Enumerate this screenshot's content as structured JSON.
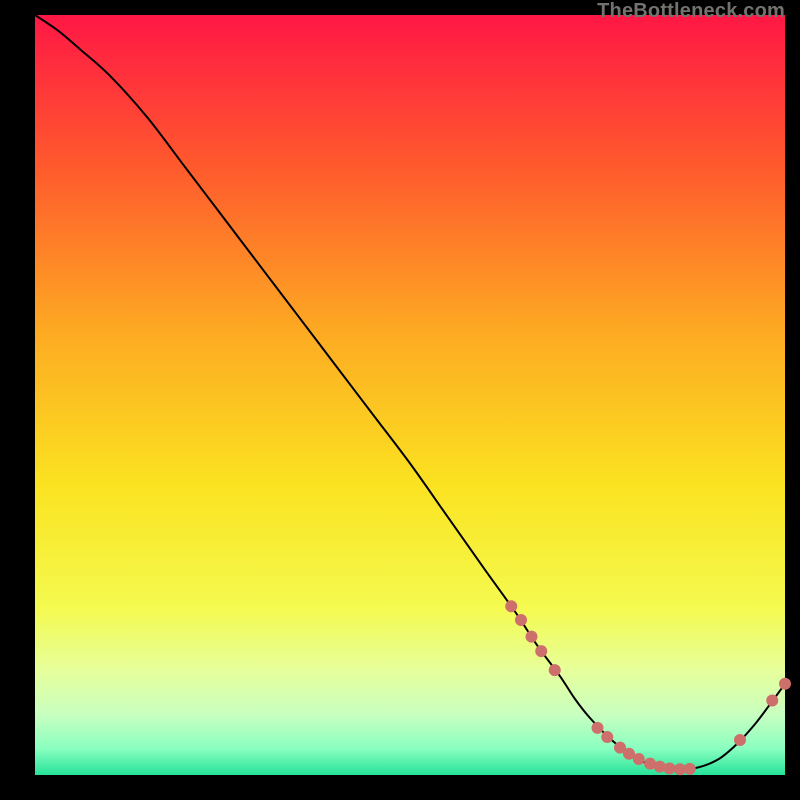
{
  "attribution": "TheBottleneck.com",
  "colors": {
    "background": "#000000",
    "curve": "#000000",
    "marker": "#cd6f6b",
    "gradient_stops": [
      {
        "pos": 0.0,
        "c": "#ff1745"
      },
      {
        "pos": 0.2,
        "c": "#ff5a2d"
      },
      {
        "pos": 0.42,
        "c": "#fdab22"
      },
      {
        "pos": 0.62,
        "c": "#fbe321"
      },
      {
        "pos": 0.78,
        "c": "#f4fa4f"
      },
      {
        "pos": 0.86,
        "c": "#e7ff99"
      },
      {
        "pos": 0.92,
        "c": "#c9ffc0"
      },
      {
        "pos": 0.965,
        "c": "#8affc0"
      },
      {
        "pos": 1.0,
        "c": "#26e39a"
      }
    ]
  },
  "chart_data": {
    "type": "line",
    "title": "",
    "xlabel": "",
    "ylabel": "",
    "xlim": [
      0,
      100
    ],
    "ylim": [
      0,
      100
    ],
    "x": [
      0,
      3,
      6,
      10,
      15,
      20,
      25,
      30,
      35,
      40,
      45,
      50,
      55,
      60,
      64,
      67,
      70,
      72,
      74,
      77,
      80,
      82.5,
      85,
      88,
      91,
      93.5,
      96,
      98,
      100
    ],
    "y": [
      100,
      98,
      95.5,
      92,
      86.5,
      80,
      73.5,
      67,
      60.5,
      54,
      47.5,
      41,
      34,
      27,
      21.5,
      17,
      13,
      10,
      7.5,
      4.5,
      2.3,
      1.2,
      0.7,
      0.9,
      2,
      4,
      6.7,
      9.3,
      12
    ],
    "markers_x": [
      63.5,
      64.8,
      66.2,
      67.5,
      69.3,
      75,
      76.3,
      78,
      79.2,
      80.5,
      82,
      83.3,
      84.6,
      86,
      87.3,
      94,
      98.3,
      100
    ],
    "markers_y": [
      22.2,
      20.4,
      18.2,
      16.3,
      13.8,
      6.2,
      5,
      3.6,
      2.8,
      2.1,
      1.5,
      1.1,
      0.85,
      0.75,
      0.8,
      4.6,
      9.8,
      12
    ]
  }
}
